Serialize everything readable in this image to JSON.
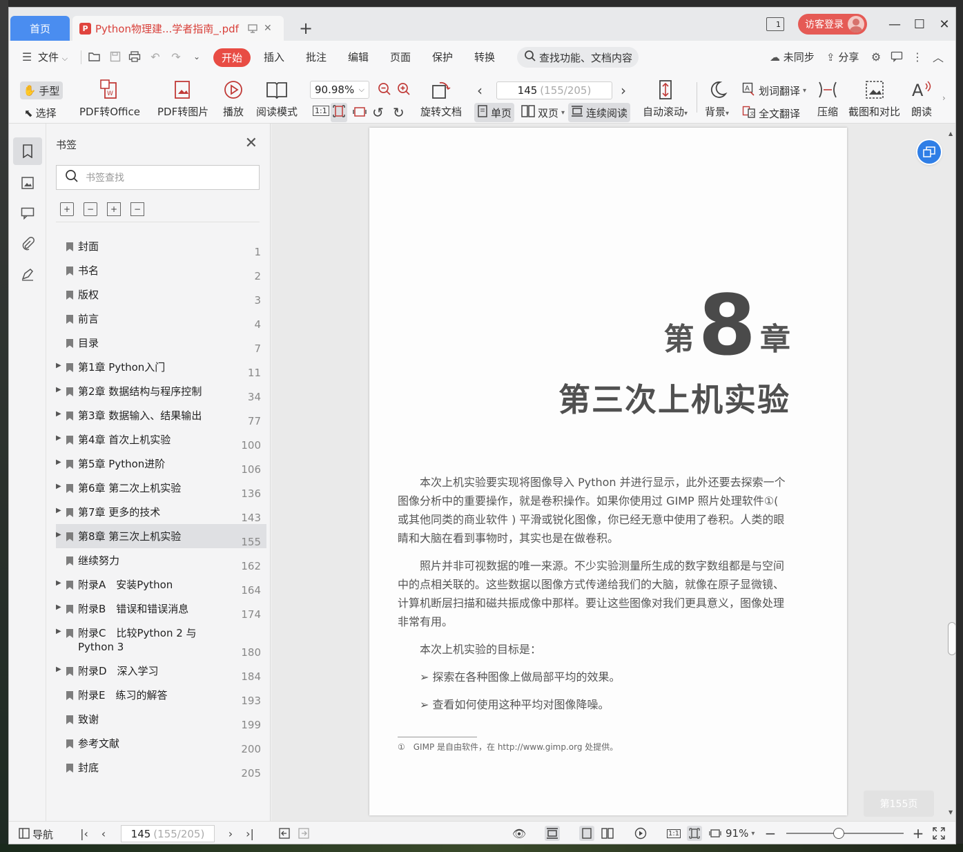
{
  "tabs": {
    "home": "首页",
    "document": "Python物理建...学者指南_.pdf"
  },
  "titlebar": {
    "reader_badge": "1",
    "login": "访客登录"
  },
  "menu": {
    "file": "文件",
    "items": [
      "开始",
      "插入",
      "批注",
      "编辑",
      "页面",
      "保护",
      "转换"
    ],
    "search": "查找功能、文档内容",
    "sync": "未同步",
    "share": "分享"
  },
  "toolbar": {
    "hand": "手型",
    "select": "选择",
    "pdf_to_office": "PDF转Office",
    "pdf_to_image": "PDF转图片",
    "play": "播放",
    "read_mode": "阅读模式",
    "zoom": "90.98%",
    "rotate": "旋转文档",
    "page_current": "145",
    "page_total": "(155/205)",
    "single_page": "单页",
    "double_page": "双页",
    "continuous": "连续阅读",
    "auto_scroll": "自动滚动",
    "background": "背景",
    "word_translate": "划词翻译",
    "full_translate": "全文翻译",
    "compress": "压缩",
    "screenshot_compare": "截图和对比",
    "read_aloud": "朗读"
  },
  "sidebar": {
    "title": "书签",
    "search_placeholder": "书签查找",
    "bookmarks": [
      {
        "label": "封面",
        "page": "1",
        "expandable": false
      },
      {
        "label": "书名",
        "page": "2",
        "expandable": false
      },
      {
        "label": "版权",
        "page": "3",
        "expandable": false
      },
      {
        "label": "前言",
        "page": "4",
        "expandable": false
      },
      {
        "label": "目录",
        "page": "7",
        "expandable": false
      },
      {
        "label": "第1章 Python入门",
        "page": "11",
        "expandable": true
      },
      {
        "label": "第2章 数据结构与程序控制",
        "page": "34",
        "expandable": true
      },
      {
        "label": "第3章 数据输入、结果输出",
        "page": "77",
        "expandable": true
      },
      {
        "label": "第4章 首次上机实验",
        "page": "100",
        "expandable": true
      },
      {
        "label": "第5章 Python进阶",
        "page": "106",
        "expandable": true
      },
      {
        "label": "第6章 第二次上机实验",
        "page": "136",
        "expandable": true
      },
      {
        "label": "第7章 更多的技术",
        "page": "143",
        "expandable": true
      },
      {
        "label": "第8章 第三次上机实验",
        "page": "155",
        "expandable": true,
        "selected": true
      },
      {
        "label": "继续努力",
        "page": "162",
        "expandable": false
      },
      {
        "label": "附录A　安装Python",
        "page": "164",
        "expandable": true
      },
      {
        "label": "附录B　错误和错误消息",
        "page": "174",
        "expandable": true
      },
      {
        "label": "附录C　比较Python 2 与Python 3",
        "page": "180",
        "expandable": true,
        "tall": true
      },
      {
        "label": "附录D　深入学习",
        "page": "184",
        "expandable": true
      },
      {
        "label": "附录E　练习的解答",
        "page": "193",
        "expandable": false
      },
      {
        "label": "致谢",
        "page": "199",
        "expandable": false
      },
      {
        "label": "参考文献",
        "page": "200",
        "expandable": false
      },
      {
        "label": "封底",
        "page": "205",
        "expandable": false
      }
    ]
  },
  "document": {
    "chapter_prefix": "第",
    "chapter_number": "8",
    "chapter_suffix": "章",
    "chapter_title": "第三次上机实验",
    "para1": "本次上机实验要实现将图像导入 Python 并进行显示，此外还要去探索一个图像分析中的重要操作，就是卷积操作。如果你使用过 GIMP 照片处理软件①( 或其他同类的商业软件 ) 平滑或锐化图像，你已经无意中使用了卷积。人类的眼睛和大脑在看到事物时，其实也是在做卷积。",
    "para2": "照片并非可视数据的唯一来源。不少实验测量所生成的数字数组都是与空间中的点相关联的。这些数据以图像方式传递给我们的大脑，就像在原子显微镜、计算机断层扫描和磁共振成像中那样。要让这些图像对我们更具意义，图像处理非常有用。",
    "para3": "本次上机实验的目标是：",
    "bullet1": "探索在各种图像上做局部平均的效果。",
    "bullet2": "查看如何使用这种平均对图像降噪。",
    "footnote": "①　GIMP 是自由软件，在 http://www.gimp.org 处提供。",
    "page_pill": "第155页"
  },
  "statusbar": {
    "nav": "导航",
    "page_current": "145",
    "page_total": "(155/205)",
    "zoom": "91%"
  }
}
